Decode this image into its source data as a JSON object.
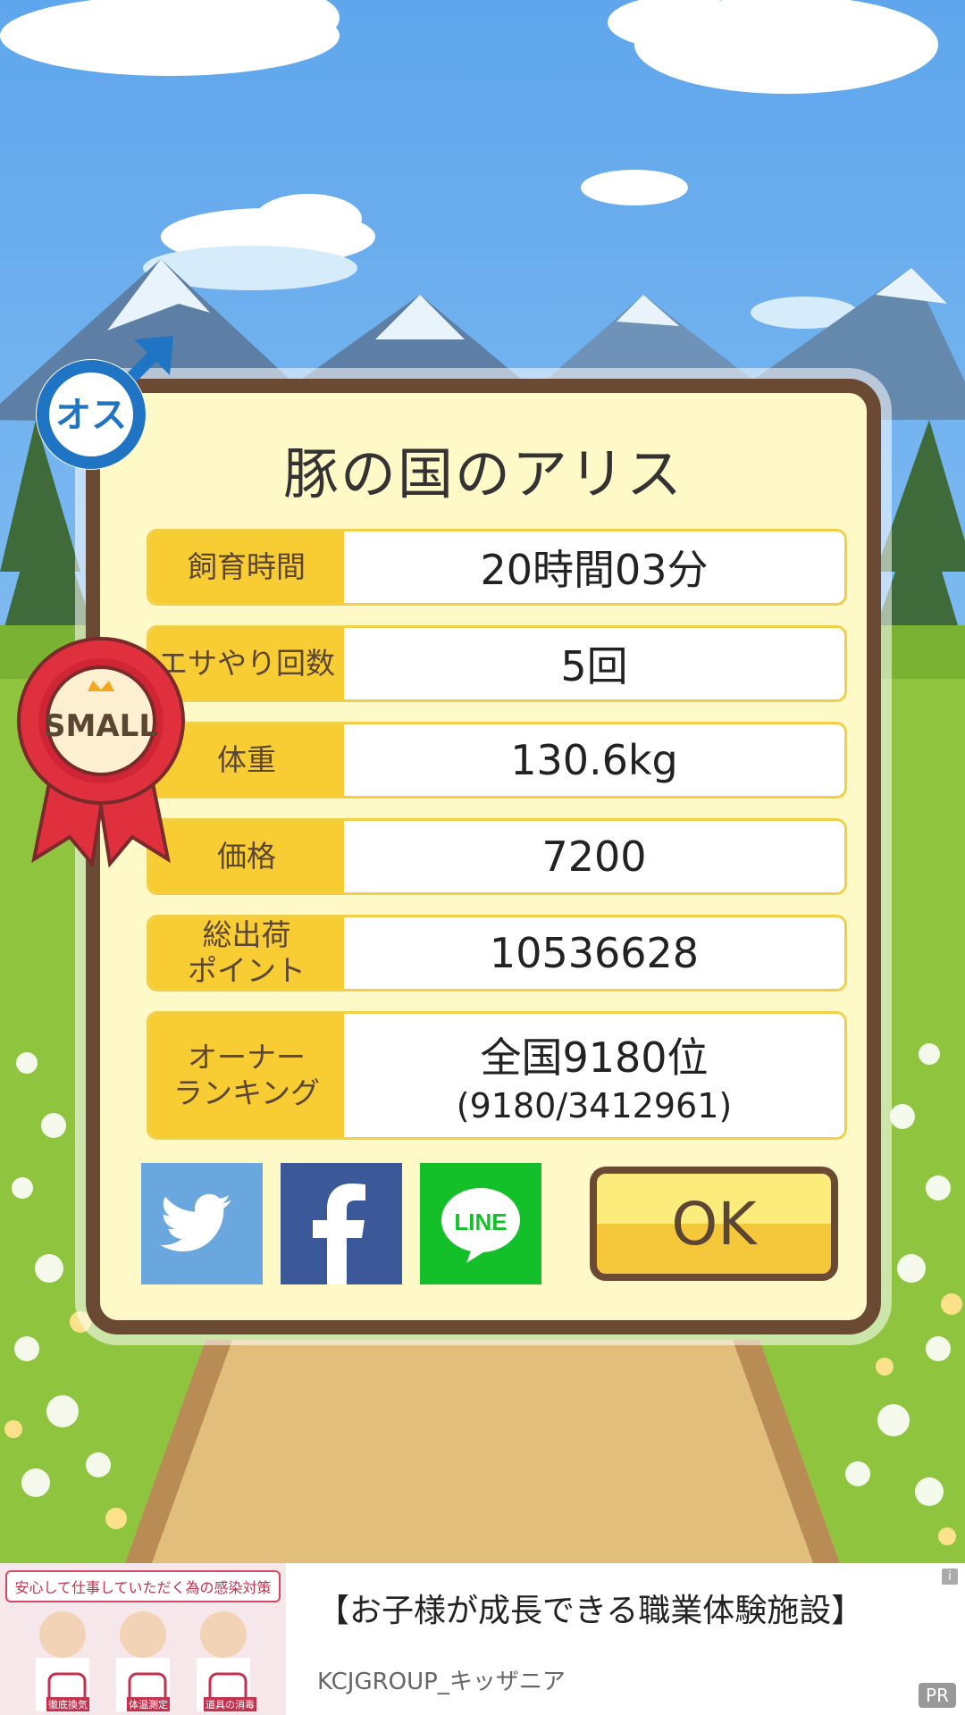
{
  "card": {
    "title": "豚の国のアリス",
    "gender_badge_text": "オス",
    "award_ribbon_text": "SMALL",
    "rows": [
      {
        "label": "飼育時間",
        "value": "20時間03分"
      },
      {
        "label": "エサやり回数",
        "value": "5回"
      },
      {
        "label": "体重",
        "value": "130.6kg"
      },
      {
        "label": "価格",
        "value": "7200"
      },
      {
        "label": "総出荷\nポイント",
        "value": "10536628"
      },
      {
        "label": "オーナー\nランキング",
        "value": "全国9180位",
        "sub_value": "(9180/3412961)"
      }
    ],
    "share": {
      "twitter_icon": "twitter-bird-icon",
      "facebook_icon": "facebook-f-icon",
      "line_label": "LINE"
    },
    "ok_label": "OK"
  },
  "ad": {
    "image_banner": "安心して仕事していただく為の感染対策",
    "image_captions": [
      "徹底換気",
      "体温測定",
      "道具の消毒"
    ],
    "title": "【お子様が成長できる職業体験施設】",
    "sponsor": "KCJGROUP_キッザニア",
    "pr_label": "PR",
    "info_label": "i"
  },
  "colors": {
    "card_bg": "#fff8c7",
    "card_border": "#6b4a34",
    "label_bg": "#f8cd34",
    "twitter": "#6aa7de",
    "facebook": "#3b5898",
    "line": "#13c02a",
    "ok_top": "#fbec7c",
    "ok_bottom": "#f4c83a"
  }
}
